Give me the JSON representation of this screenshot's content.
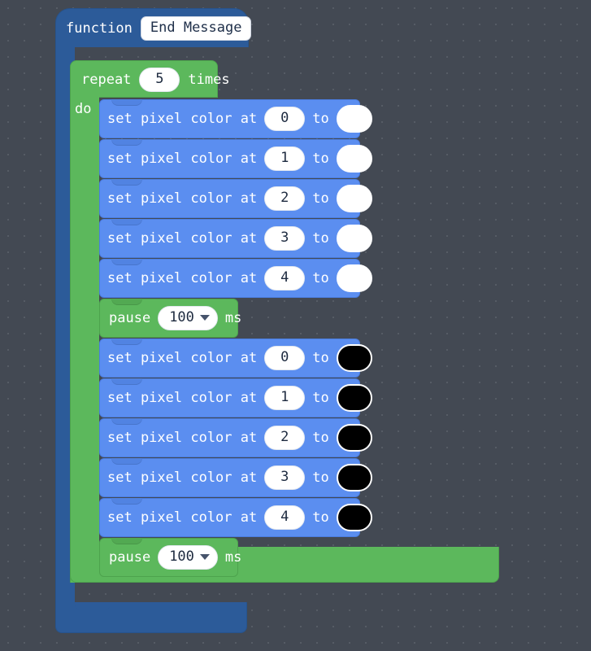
{
  "editor": {
    "background_color": "#434953",
    "dot_grid": true
  },
  "palette": {
    "function_blue": "#2C5B99",
    "loop_green": "#5CB85C",
    "pixel_blue": "#5B8EF0",
    "field_white": "#FFFFFF",
    "text_white": "#FFFFFF",
    "field_text": "#1D2A3F"
  },
  "function_block": {
    "keyword": "function",
    "name": "End Message"
  },
  "repeat_block": {
    "keyword": "repeat",
    "times_count": "5",
    "times_label": "times",
    "do_label": "do"
  },
  "statements": [
    {
      "kind": "set-pixel",
      "prefix": "set pixel color at",
      "index": "0",
      "to_label": "to",
      "color": "#FFFFFF",
      "color_name": "white"
    },
    {
      "kind": "set-pixel",
      "prefix": "set pixel color at",
      "index": "1",
      "to_label": "to",
      "color": "#FFFFFF",
      "color_name": "white"
    },
    {
      "kind": "set-pixel",
      "prefix": "set pixel color at",
      "index": "2",
      "to_label": "to",
      "color": "#FFFFFF",
      "color_name": "white"
    },
    {
      "kind": "set-pixel",
      "prefix": "set pixel color at",
      "index": "3",
      "to_label": "to",
      "color": "#FFFFFF",
      "color_name": "white"
    },
    {
      "kind": "set-pixel",
      "prefix": "set pixel color at",
      "index": "4",
      "to_label": "to",
      "color": "#FFFFFF",
      "color_name": "white"
    },
    {
      "kind": "pause",
      "prefix": "pause",
      "value": "100",
      "unit": "ms"
    },
    {
      "kind": "set-pixel",
      "prefix": "set pixel color at",
      "index": "0",
      "to_label": "to",
      "color": "#000000",
      "color_name": "black"
    },
    {
      "kind": "set-pixel",
      "prefix": "set pixel color at",
      "index": "1",
      "to_label": "to",
      "color": "#000000",
      "color_name": "black"
    },
    {
      "kind": "set-pixel",
      "prefix": "set pixel color at",
      "index": "2",
      "to_label": "to",
      "color": "#000000",
      "color_name": "black"
    },
    {
      "kind": "set-pixel",
      "prefix": "set pixel color at",
      "index": "3",
      "to_label": "to",
      "color": "#000000",
      "color_name": "black"
    },
    {
      "kind": "set-pixel",
      "prefix": "set pixel color at",
      "index": "4",
      "to_label": "to",
      "color": "#000000",
      "color_name": "black"
    },
    {
      "kind": "pause",
      "prefix": "pause",
      "value": "100",
      "unit": "ms"
    }
  ]
}
